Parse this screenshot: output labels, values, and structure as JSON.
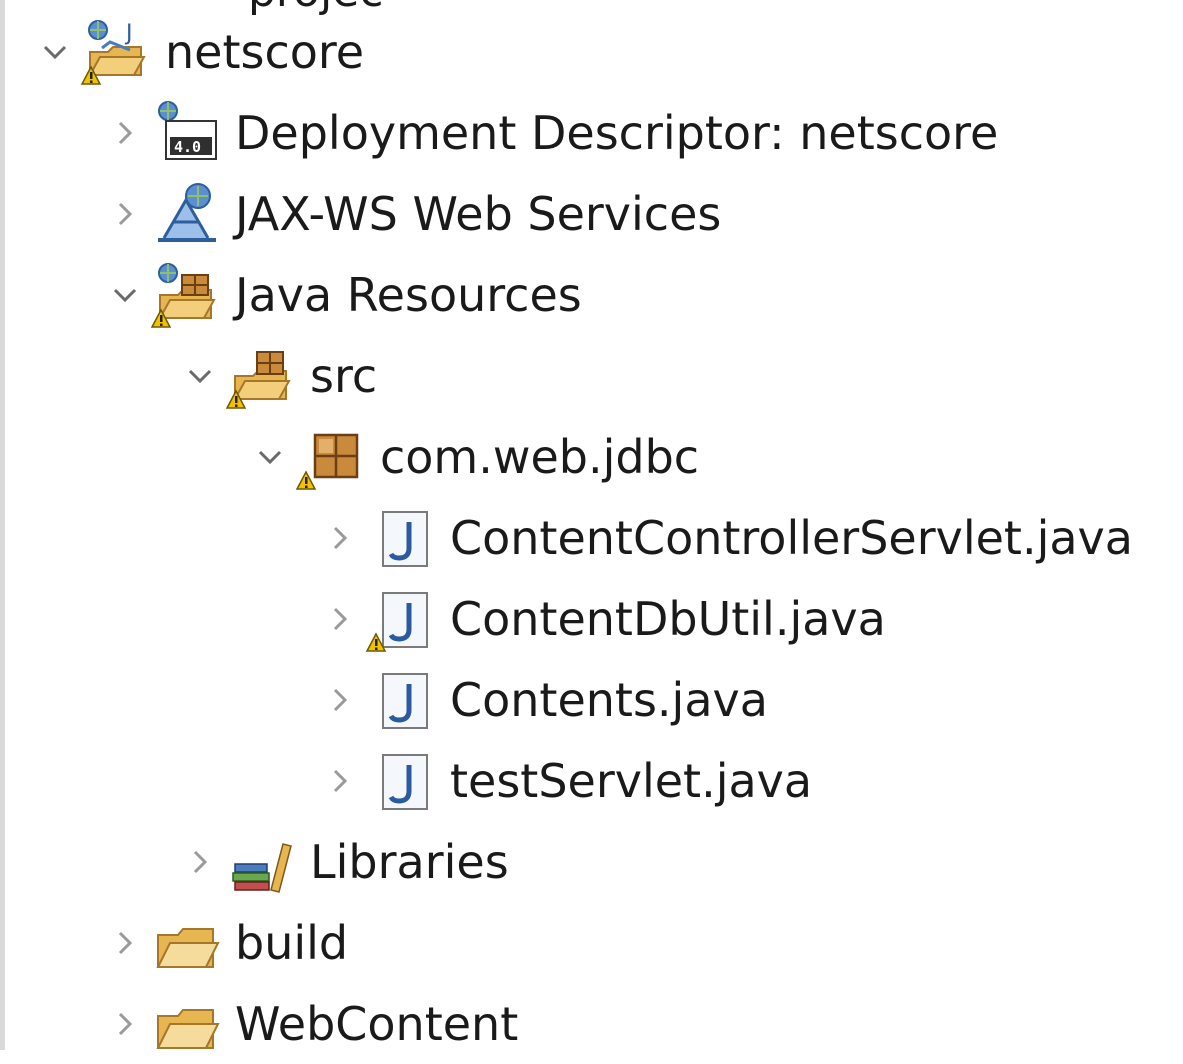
{
  "clipped_top_text": "projec",
  "tree": {
    "nodes": [
      {
        "id": "netscore",
        "label": "netscore",
        "expanded": true,
        "icon": "web-project-icon",
        "warning": true
      },
      {
        "id": "deployment",
        "label": "Deployment Descriptor: netscore",
        "expanded": false,
        "icon": "deployment-descriptor-icon",
        "warning": false
      },
      {
        "id": "jaxws",
        "label": "JAX-WS Web Services",
        "expanded": false,
        "icon": "web-services-icon",
        "warning": false
      },
      {
        "id": "javares",
        "label": "Java Resources",
        "expanded": true,
        "icon": "java-resources-icon",
        "warning": true
      },
      {
        "id": "src",
        "label": "src",
        "expanded": true,
        "icon": "source-folder-icon",
        "warning": true
      },
      {
        "id": "pkg",
        "label": "com.web.jdbc",
        "expanded": true,
        "icon": "package-icon",
        "warning": true
      },
      {
        "id": "f1",
        "label": "ContentControllerServlet.java",
        "expanded": false,
        "icon": "java-file-icon",
        "warning": false
      },
      {
        "id": "f2",
        "label": "ContentDbUtil.java",
        "expanded": false,
        "icon": "java-file-icon",
        "warning": true
      },
      {
        "id": "f3",
        "label": "Contents.java",
        "expanded": false,
        "icon": "java-file-icon",
        "warning": false
      },
      {
        "id": "f4",
        "label": "testServlet.java",
        "expanded": false,
        "icon": "java-file-icon",
        "warning": false
      },
      {
        "id": "libs",
        "label": "Libraries",
        "expanded": false,
        "icon": "libraries-icon",
        "warning": false
      },
      {
        "id": "build",
        "label": "build",
        "expanded": false,
        "icon": "folder-icon",
        "warning": false
      },
      {
        "id": "webcontent",
        "label": "WebContent",
        "expanded": false,
        "icon": "folder-icon",
        "warning": false
      }
    ]
  },
  "colors": {
    "warning": "#f2c200",
    "folder": "#e8b650",
    "java_blue": "#2c5aa0",
    "chevron": "#8a8a8a"
  }
}
